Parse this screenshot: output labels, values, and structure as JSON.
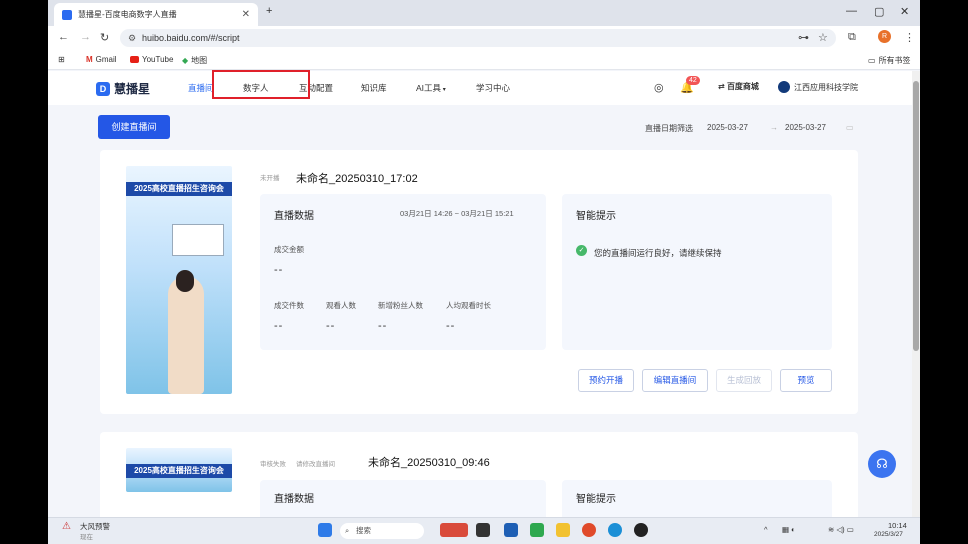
{
  "browser": {
    "tab_title": "慧播星-百度电商数字人直播",
    "url": "huibo.baidu.com/#/script",
    "bookmarks": [
      "Gmail",
      "YouTube",
      "地图"
    ],
    "bookmarks_folder": "所有书签",
    "profile_initial": "R"
  },
  "app": {
    "logo": "慧播星",
    "nav": [
      "直播间",
      "数字人",
      "互动配置",
      "知识库",
      "AI工具",
      "学习中心"
    ],
    "notification_count": "42",
    "baidu_mall": "百度商城",
    "org_name": "江西应用科技学院"
  },
  "toolbar": {
    "create_button": "创建直播间",
    "filter_label": "直播日期筛选",
    "date_from": "2025-03-27",
    "date_to": "2025-03-27"
  },
  "cards": [
    {
      "thumb_banner": "2025高校直播招生咨询会",
      "status_tag": "未开播",
      "title": "未命名_20250310_17:02",
      "data_title": "直播数据",
      "time_range": "03月21日 14:26 ~ 03月21日 15:21",
      "amount_label": "成交金额",
      "amount_value": "--",
      "metrics": [
        {
          "label": "成交件数",
          "value": "--"
        },
        {
          "label": "观看人数",
          "value": "--"
        },
        {
          "label": "新增粉丝人数",
          "value": "--"
        },
        {
          "label": "人均观看时长",
          "value": "--"
        }
      ],
      "tips_title": "智能提示",
      "tip_text": "您的直播间运行良好，请继续保持",
      "buttons": [
        "预约开播",
        "编辑直播间",
        "生成回放",
        "预览"
      ]
    },
    {
      "thumb_banner": "2025高校直播招生咨询会",
      "status_tag": "审核失败",
      "status_note": "请修改直播间",
      "title": "未命名_20250310_09:46",
      "data_title": "直播数据",
      "tips_title": "智能提示"
    }
  ],
  "taskbar": {
    "weather": "大风预警",
    "weather_sub": "现在",
    "search": "搜索",
    "time": "10:14",
    "date": "2025/3/27"
  }
}
